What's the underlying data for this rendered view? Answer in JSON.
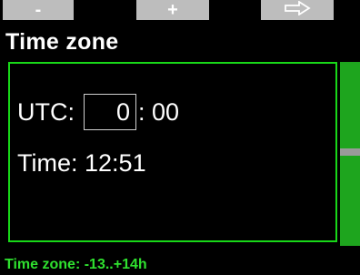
{
  "softkeys": {
    "left_label": "-",
    "center_label": "+",
    "right_icon": "right-arrow-outline-icon"
  },
  "header": {
    "title": "Time zone"
  },
  "panel": {
    "utc_label": "UTC:",
    "utc_hours": "0",
    "utc_minutes": ": 00",
    "time_label": "Time:",
    "time_value": "12:51"
  },
  "hint": {
    "text": "Time zone: -13..+14h"
  },
  "colors": {
    "accent_green": "#18d818",
    "softkey_gray": "#bdbdbd",
    "scrollbar_green": "#1ea51e",
    "background": "#000000"
  }
}
